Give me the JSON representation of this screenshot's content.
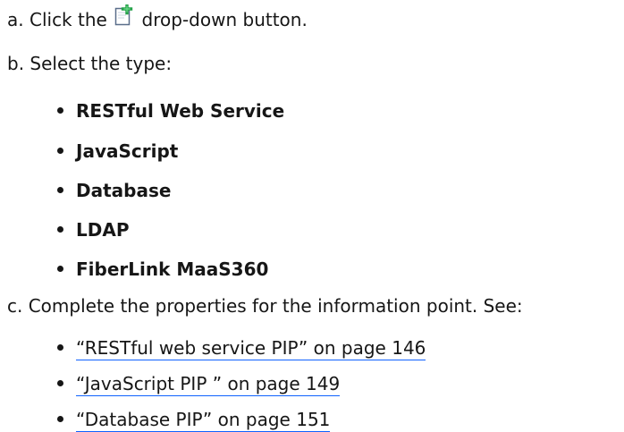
{
  "steps": {
    "a": {
      "marker": "a.",
      "text_before": "Click the",
      "icon": "new-document-plus-icon",
      "text_after": "drop-down button."
    },
    "b": {
      "marker": "b.",
      "text": "Select the type:"
    },
    "types": [
      "RESTful Web Service",
      "JavaScript",
      "Database",
      "LDAP",
      "FiberLink MaaS360"
    ],
    "c": {
      "marker": "c.",
      "text": "Complete the properties for the information point. See:"
    },
    "links": [
      {
        "label": "“RESTful web service PIP” on page 146"
      },
      {
        "label": "“JavaScript PIP ” on page 149"
      },
      {
        "label": "“Database PIP” on page 151"
      }
    ]
  },
  "colors": {
    "text": "#161616",
    "link_underline": "#0f62fe",
    "icon_plus": "#24a148"
  }
}
